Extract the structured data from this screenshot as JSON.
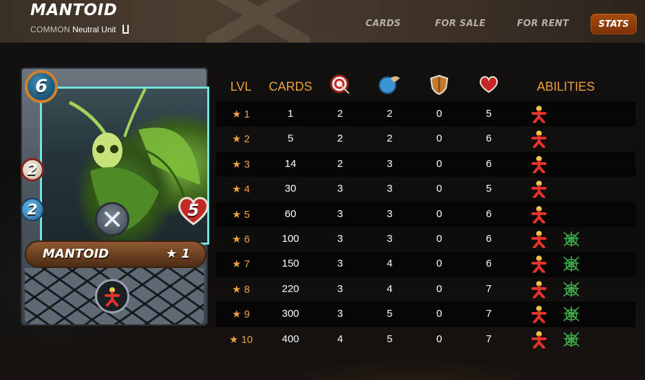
{
  "header": {
    "card_name": "MANTOID",
    "rarity": "COMMON",
    "element_type": "Neutral Unit",
    "tabs": [
      {
        "label": "CARDS"
      },
      {
        "label": "FOR SALE"
      },
      {
        "label": "FOR RENT"
      },
      {
        "label": "STATS",
        "active": true
      }
    ]
  },
  "card": {
    "mana": "6",
    "ranged": "2",
    "speed": "2",
    "health": "5",
    "name": "MANTOID",
    "level": "★ 1",
    "ability_icon": "taunt-icon"
  },
  "stats": {
    "headers": {
      "lvl": "LVL",
      "cards": "CARDS",
      "ranged_icon": "ranged-attack-icon",
      "speed_icon": "speed-icon",
      "armor_icon": "armor-icon",
      "health_icon": "health-icon",
      "abilities": "ABILITIES"
    },
    "rows": [
      {
        "lvl": "★ 1",
        "cards": "1",
        "ranged": "2",
        "speed": "2",
        "armor": "0",
        "health": "5",
        "abilities": [
          "taunt-icon"
        ]
      },
      {
        "lvl": "★ 2",
        "cards": "5",
        "ranged": "2",
        "speed": "2",
        "armor": "0",
        "health": "6",
        "abilities": [
          "taunt-icon"
        ]
      },
      {
        "lvl": "★ 3",
        "cards": "14",
        "ranged": "2",
        "speed": "3",
        "armor": "0",
        "health": "6",
        "abilities": [
          "taunt-icon"
        ]
      },
      {
        "lvl": "★ 4",
        "cards": "30",
        "ranged": "3",
        "speed": "3",
        "armor": "0",
        "health": "5",
        "abilities": [
          "taunt-icon"
        ]
      },
      {
        "lvl": "★ 5",
        "cards": "60",
        "ranged": "3",
        "speed": "3",
        "armor": "0",
        "health": "6",
        "abilities": [
          "taunt-icon"
        ]
      },
      {
        "lvl": "★ 6",
        "cards": "100",
        "ranged": "3",
        "speed": "3",
        "armor": "0",
        "health": "6",
        "abilities": [
          "taunt-icon",
          "web-icon"
        ]
      },
      {
        "lvl": "★ 7",
        "cards": "150",
        "ranged": "3",
        "speed": "4",
        "armor": "0",
        "health": "6",
        "abilities": [
          "taunt-icon",
          "web-icon"
        ]
      },
      {
        "lvl": "★ 8",
        "cards": "220",
        "ranged": "3",
        "speed": "4",
        "armor": "0",
        "health": "7",
        "abilities": [
          "taunt-icon",
          "web-icon"
        ]
      },
      {
        "lvl": "★ 9",
        "cards": "300",
        "ranged": "3",
        "speed": "5",
        "armor": "0",
        "health": "7",
        "abilities": [
          "taunt-icon",
          "web-icon"
        ]
      },
      {
        "lvl": "★ 10",
        "cards": "400",
        "ranged": "4",
        "speed": "5",
        "armor": "0",
        "health": "7",
        "abilities": [
          "taunt-icon",
          "web-icon"
        ]
      }
    ]
  },
  "colors": {
    "accent": "#f0a23c",
    "active_tab": "#8a3a08",
    "tab_text": "#b7aea4"
  }
}
